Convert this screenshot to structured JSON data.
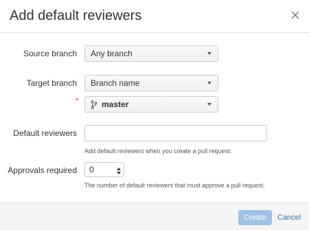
{
  "dialog": {
    "title": "Add default reviewers",
    "close_icon": "close-icon"
  },
  "form": {
    "source_branch": {
      "label": "Source branch",
      "value": "Any branch"
    },
    "target_branch": {
      "label": "Target branch",
      "value": "Branch name"
    },
    "branch_pattern": {
      "required_marker": "*",
      "icon": "branch-icon",
      "value": "master"
    },
    "default_reviewers": {
      "label": "Default reviewers",
      "value": "",
      "help": "Add default reviewers when you create a pull request."
    },
    "approvals_required": {
      "label": "Approvals required",
      "value": "0",
      "help": "The number of default reviewers that must approve a pull request."
    }
  },
  "footer": {
    "create_label": "Create",
    "cancel_label": "Cancel"
  },
  "colors": {
    "primary_disabled": "#9fc1e6",
    "link": "#3572b0",
    "required": "#d04437"
  }
}
